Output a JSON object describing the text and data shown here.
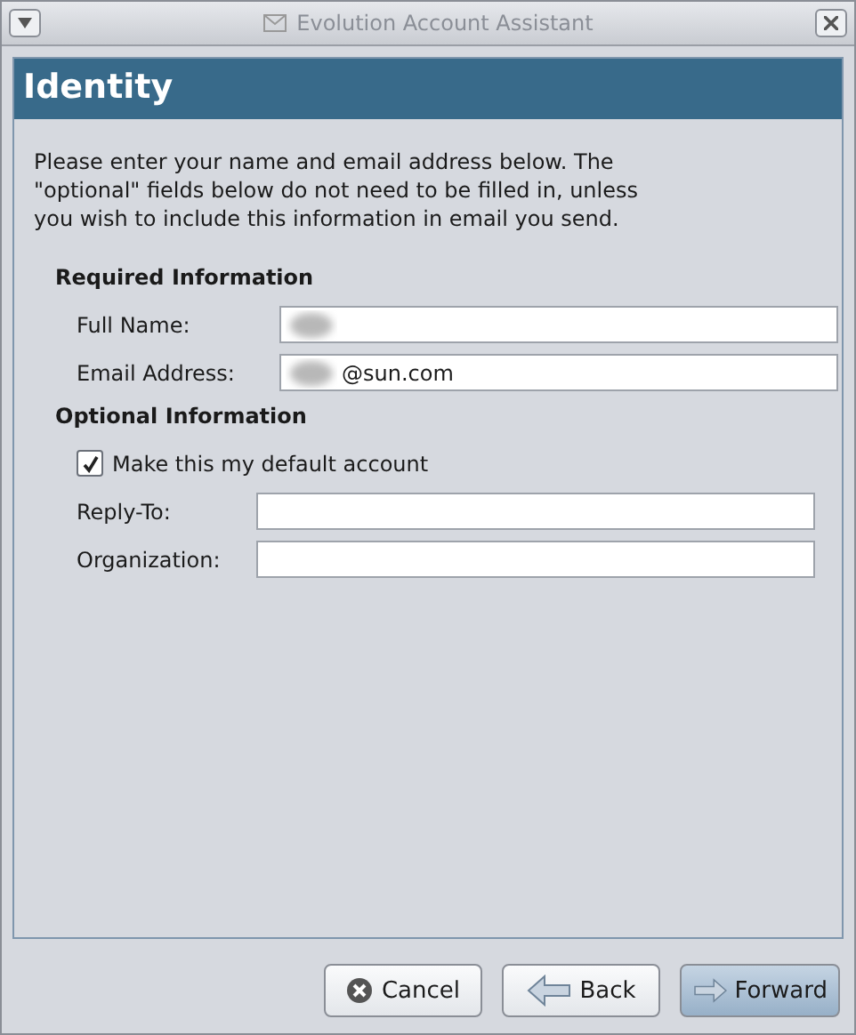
{
  "window": {
    "title": "Evolution Account Assistant"
  },
  "page": {
    "title": "Identity",
    "intro": "Please enter your name and email address below. The \"optional\" fields below do not need to be filled in, unless you wish to include this information in email you send."
  },
  "required": {
    "heading": "Required Information",
    "fields": [
      {
        "label": "Full Name:",
        "redacted": true
      },
      {
        "label": "Email Address:",
        "value": "@sun.com",
        "redacted": true
      }
    ]
  },
  "optional": {
    "heading": "Optional Information",
    "default_account": {
      "label": "Make this my default account",
      "checked": true
    },
    "fields": [
      {
        "label": "Reply-To:",
        "redacted": false
      },
      {
        "label": "Organization:",
        "redacted": false
      }
    ]
  },
  "buttons": [
    {
      "label": "Cancel",
      "kind": "cancel",
      "default": false
    },
    {
      "label": "Back",
      "kind": "back",
      "default": false
    },
    {
      "label": "Forward",
      "kind": "forward",
      "default": true
    }
  ]
}
